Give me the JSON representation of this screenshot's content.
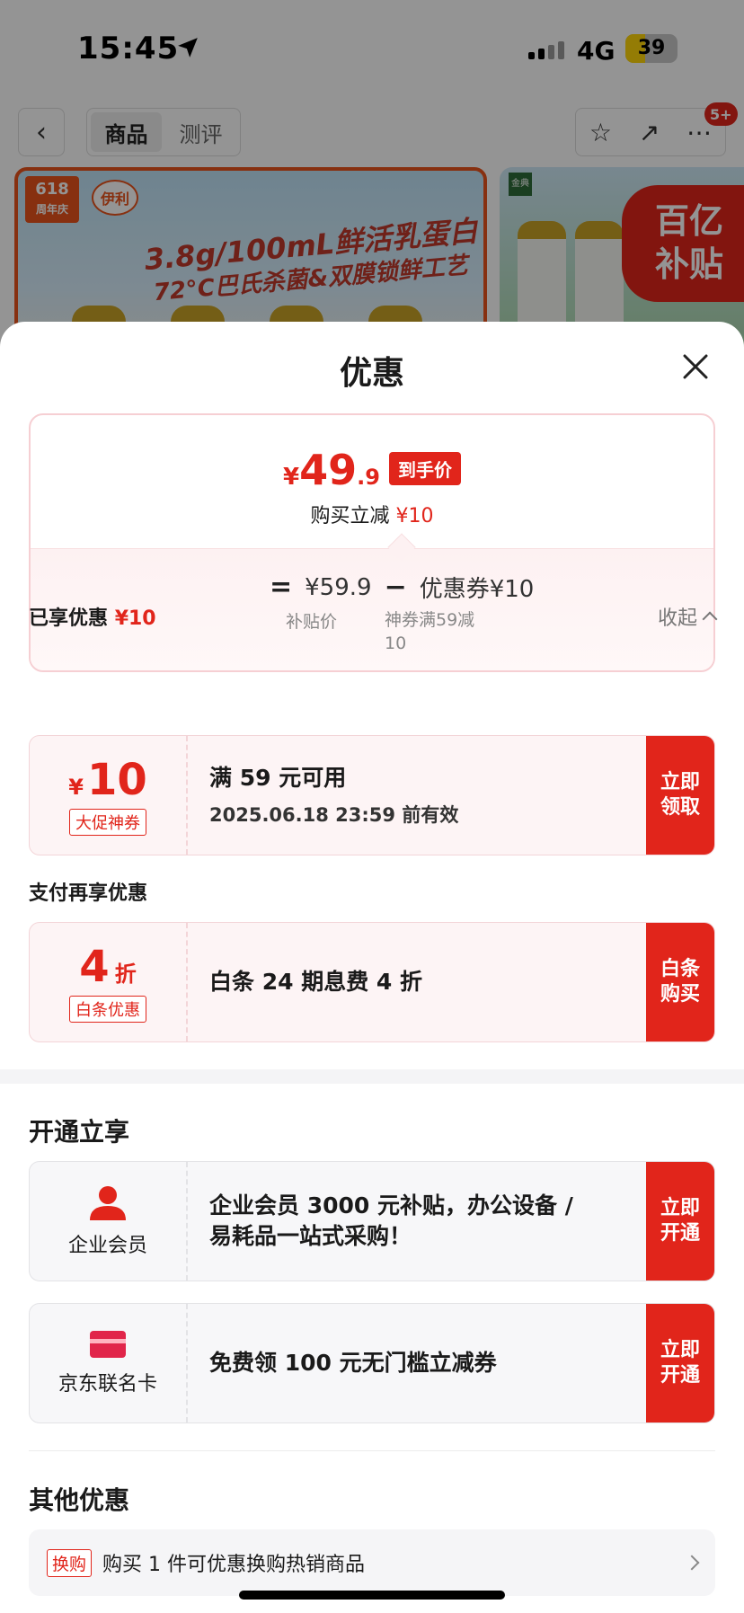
{
  "status_bar": {
    "time": "15:45",
    "network": "4G",
    "battery": "39",
    "battery_level": 0.39
  },
  "nav": {
    "back_icon": "chevron-left-icon",
    "tabs": [
      {
        "label": "商品",
        "active": true
      },
      {
        "label": "测评",
        "active": false
      }
    ],
    "message_badge": "5+"
  },
  "banner": {
    "anniversary": "618",
    "anniversary_sub": "周年庆",
    "brand": "伊利",
    "line1": "3.8g/100mL鲜活乳蛋白",
    "line2": "72°C巴氏杀菌&双膜锁鲜工艺",
    "side_brand": "金典",
    "subsidy_line1": "百亿",
    "subsidy_line2": "补贴"
  },
  "sheet": {
    "title": "优惠",
    "price_card": {
      "currency": "¥",
      "price_int": "49",
      "price_dec": ".9",
      "price_tag": "到手价",
      "reduce_label": "购买立减",
      "reduce_value": "¥10",
      "equals": "=",
      "subsidy_price": "¥59.9",
      "minus": "−",
      "coupon_part": "优惠券¥10",
      "subsidy_label": "补贴价",
      "coupon_label": "神券满59减10"
    },
    "enjoyed": {
      "label": "已享优惠",
      "value": "¥10",
      "collapse": "收起"
    },
    "coupon1": {
      "currency": "¥",
      "value": "10",
      "tag": "大促神券",
      "title": "满 59 元可用",
      "validity": "2025.06.18 23:59 前有效",
      "button": "立即领取"
    },
    "pay_section_label": "支付再享优惠",
    "coupon2": {
      "value": "4",
      "suffix": "折",
      "tag": "白条优惠",
      "title": "白条 24 期息费 4 折",
      "button": "白条购买"
    },
    "open_section": {
      "title": "开通立享",
      "items": [
        {
          "name": "企业会员",
          "icon": "person-icon",
          "text": " 企业会员 3000 元补贴，办公设备 / 易耗品一站式采购！",
          "button": "立即开通"
        },
        {
          "name": "京东联名卡",
          "icon": "credit-card-icon",
          "text": "免费领 100 元无门槛立减券",
          "button": "立即开通"
        }
      ]
    },
    "other_section": {
      "title": "其他优惠",
      "tag": "换购",
      "text": "购买 1 件可优惠换购热销商品"
    }
  },
  "colors": {
    "accent": "#e1251b",
    "price_border": "#f6cfd3"
  }
}
